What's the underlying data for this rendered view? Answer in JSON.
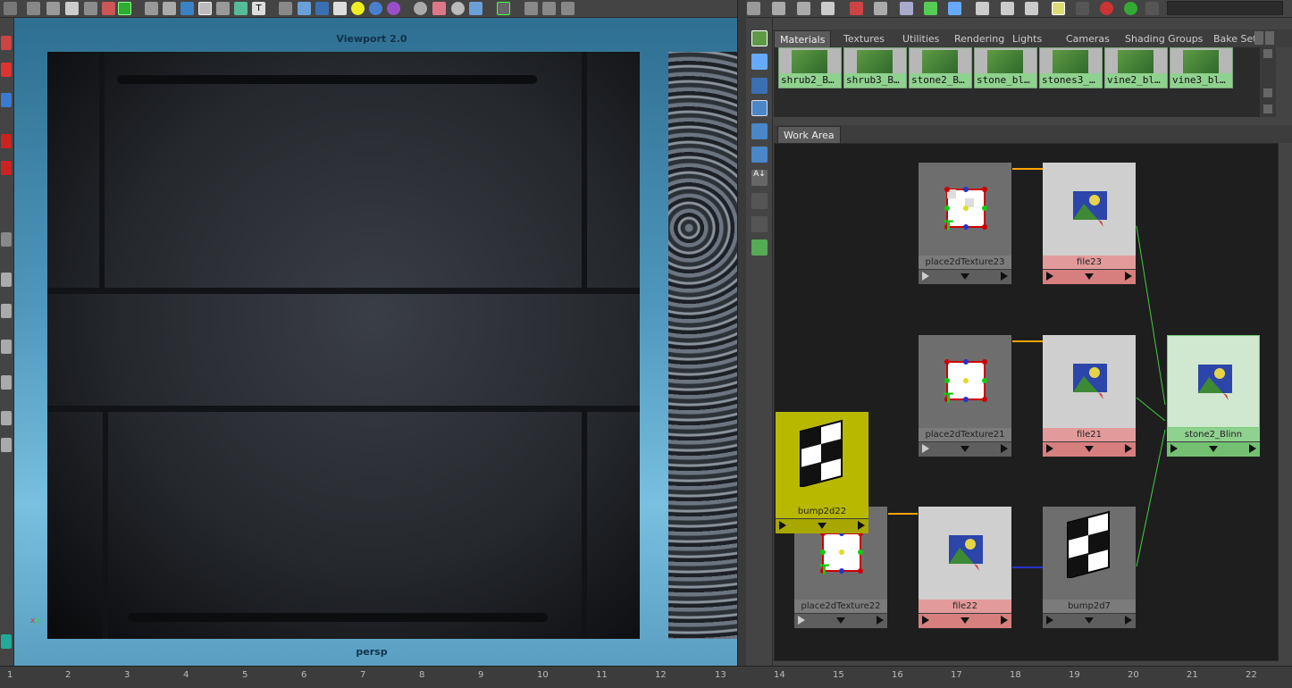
{
  "viewport": {
    "title": "Viewport 2.0",
    "camera": "persp"
  },
  "editor": {
    "tabs": [
      "Materials",
      "Textures",
      "Utilities",
      "Rendering",
      "Lights",
      "Cameras",
      "Shading Groups",
      "Bake Set"
    ],
    "active_tab": "Materials",
    "swatches": [
      "shrub2_B…",
      "shrub3_B…",
      "stone2_B…",
      "stone_bl…",
      "stones3_…",
      "vine2_bl…",
      "vine3_bl…"
    ],
    "work_area_tab": "Work Area"
  },
  "nodes": {
    "place2dTexture23": "place2dTexture23",
    "file23": "file23",
    "place2dTexture21": "place2dTexture21",
    "file21": "file21",
    "stone2_Blinn": "stone2_Blinn",
    "bump2d22": "bump2d22",
    "place2dTexture22": "place2dTexture22",
    "file22": "file22",
    "bump2d7": "bump2d7"
  },
  "ruler": [
    "1",
    "2",
    "3",
    "4",
    "5",
    "6",
    "7",
    "8",
    "9",
    "10",
    "11",
    "12",
    "13",
    "14",
    "15",
    "16",
    "17",
    "18",
    "19",
    "20",
    "21",
    "22"
  ],
  "colors": {
    "viewport_bg": "#4f97bd",
    "file_node": "#e39a9a",
    "blinn_node": "#8fd18f",
    "bump_selected": "#b9b800",
    "connection_green": "#3fd13f",
    "connection_orange": "#ffa500"
  }
}
